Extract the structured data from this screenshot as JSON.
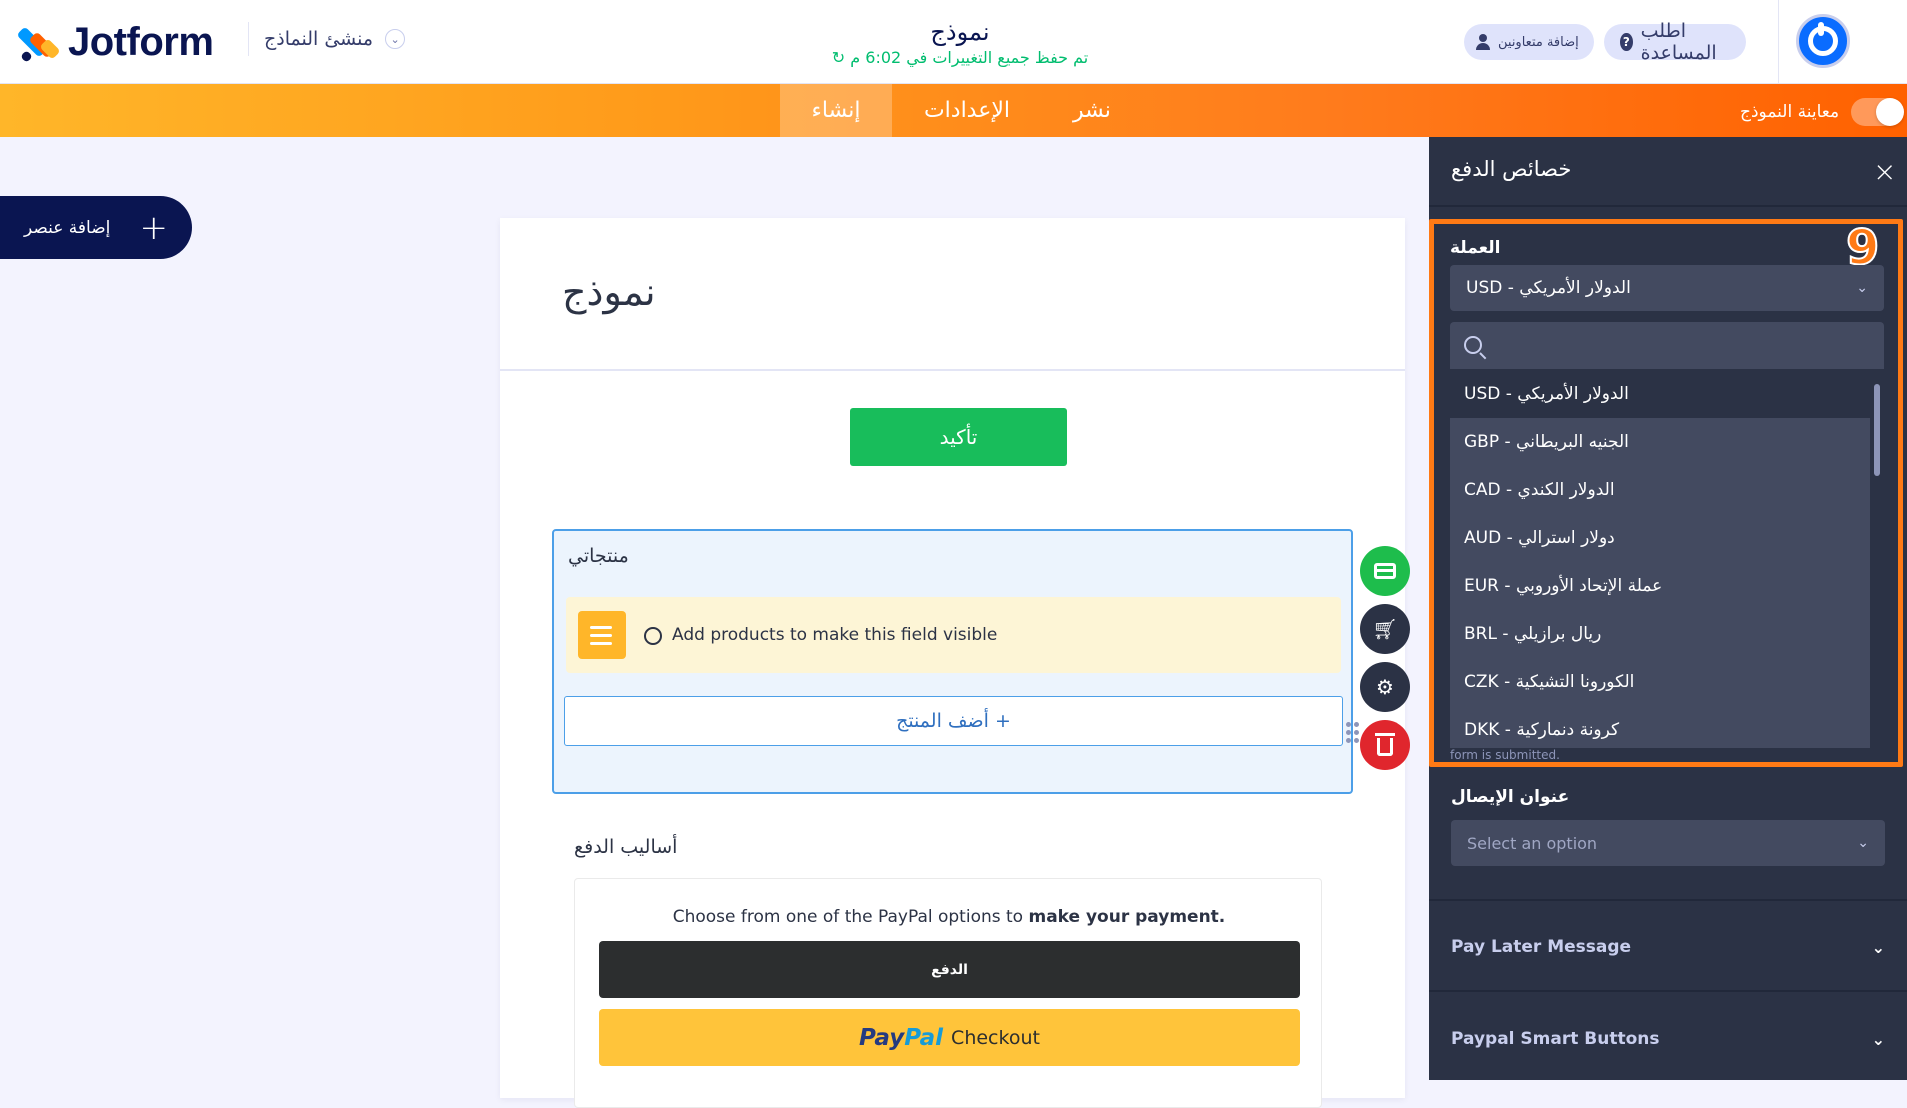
{
  "app": {
    "brand": "Jotform",
    "builder_menu": "منشئ النماذج",
    "form_title": "نموذج",
    "save_status": "تم حفظ جميع التغييرات في 6:02 م",
    "help_label": "اطلب المساعدة",
    "collab_label": "إضافة متعاونين"
  },
  "nav": {
    "tabs": [
      {
        "label": "إنشاء"
      },
      {
        "label": "الإعدادات"
      },
      {
        "label": "نشر"
      }
    ],
    "preview_label": "معاينة النموذج"
  },
  "left": {
    "add_element": "إضافة عنصر"
  },
  "form": {
    "heading": "نموذج",
    "submit_label": "تأكيد",
    "products_label": "منتجاتي",
    "products_notice": "Add products to make this field visible",
    "add_product_label": "أضف المنتج +",
    "payment_methods_label": "أساليب الدفع",
    "paypal_intro": "Choose from one of the PayPal options to",
    "paypal_intro_bold": "make your payment.",
    "pay_button": "الدفع",
    "paypal_brand_a": "Pay",
    "paypal_brand_b": "Pal",
    "paypal_checkout": "Checkout"
  },
  "panel": {
    "title": "خصائص الدفع",
    "step_badge": "9",
    "currency_label": "العملة",
    "currency_selected": "USD - الدولار الأمريكي",
    "currency_options": [
      "USD - الدولار الأمريكي",
      "GBP - الجنيه البريطاني",
      "CAD - الدولار الكندي",
      "AUD - دولار استرالي",
      "EUR - عملة الإتحاد الأوروبي",
      "BRL - ريال برازيلي",
      "CZK - الكورونا التشيكية",
      "DKK - كرونة دنماركية"
    ],
    "cut_note": "form is submitted.",
    "address_label": "عنوان الإيصال",
    "address_placeholder": "Select an option",
    "pay_later": "Pay Later Message",
    "smart_buttons": "Paypal Smart Buttons"
  },
  "colors": {
    "brand_orange": "#ff6100",
    "highlight": "#ff7a15",
    "submit_green": "#18bd5b",
    "panel_bg": "#2b3245",
    "paypal_yellow": "#ffc43a"
  }
}
